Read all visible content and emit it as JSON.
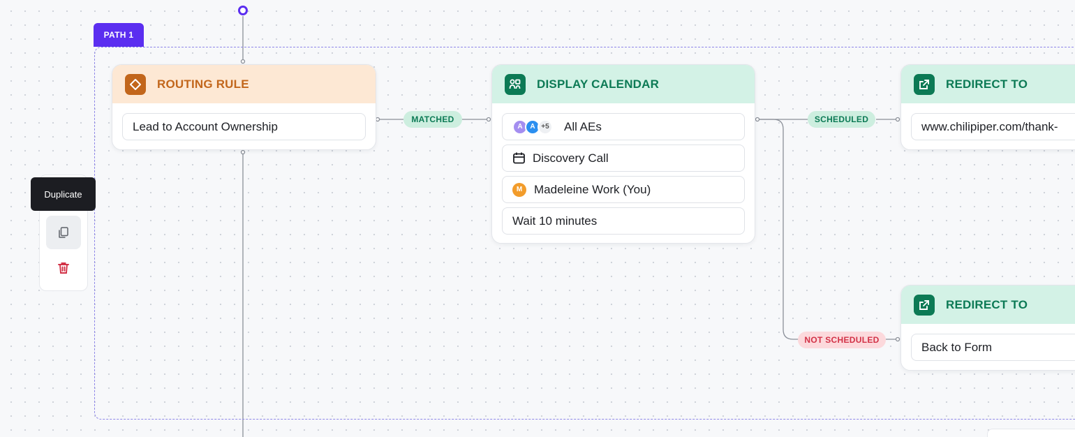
{
  "path": {
    "label": "PATH 1"
  },
  "routing_rule": {
    "title": "ROUTING RULE",
    "rule": "Lead to Account Ownership"
  },
  "edges": {
    "matched": "MATCHED",
    "scheduled": "SCHEDULED",
    "not_scheduled": "NOT SCHEDULED"
  },
  "display_calendar": {
    "title": "DISPLAY CALENDAR",
    "assignees": {
      "avatars": [
        "A",
        "A"
      ],
      "more": "+5",
      "label": "All AEs"
    },
    "meeting_type": "Discovery Call",
    "owner": {
      "initial": "M",
      "name": "Madeleine Work (You)"
    },
    "wait": "Wait 10 minutes"
  },
  "redirect_scheduled": {
    "title": "REDIRECT TO",
    "url": "www.chilipiper.com/thank-"
  },
  "redirect_not_scheduled": {
    "title": "REDIRECT TO",
    "target": "Back to Form"
  },
  "toolbar": {
    "tooltip": "Duplicate"
  },
  "colors": {
    "path_accent": "#5b2ef0",
    "routing_accent": "#c2661b",
    "routing_header_bg": "#fde8d4",
    "calendar_accent": "#0c7a55",
    "calendar_header_bg": "#d3f2e6",
    "danger": "#d23247"
  },
  "icons": {
    "routing": "diamond-icon",
    "calendar": "people-calendar-icon",
    "redirect": "external-link-icon",
    "meeting": "calendar-icon",
    "duplicate": "copy-icon",
    "delete": "trash-icon"
  }
}
